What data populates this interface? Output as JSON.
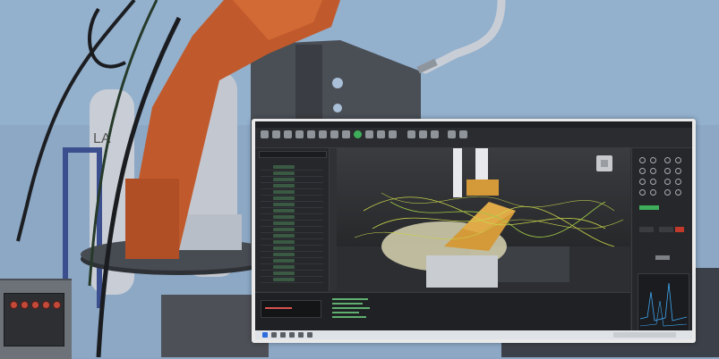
{
  "scene": {
    "description_free": true,
    "background_color": "#8aa6c4",
    "robot_color": "#c0582e",
    "monitor_bezel_color": "#e9e9e9"
  },
  "software_ui": {
    "theme": "dark",
    "accent": "#3fae5a",
    "viewport_object_color": "#d49a3a",
    "trajectory_color": "#c9d24a"
  }
}
